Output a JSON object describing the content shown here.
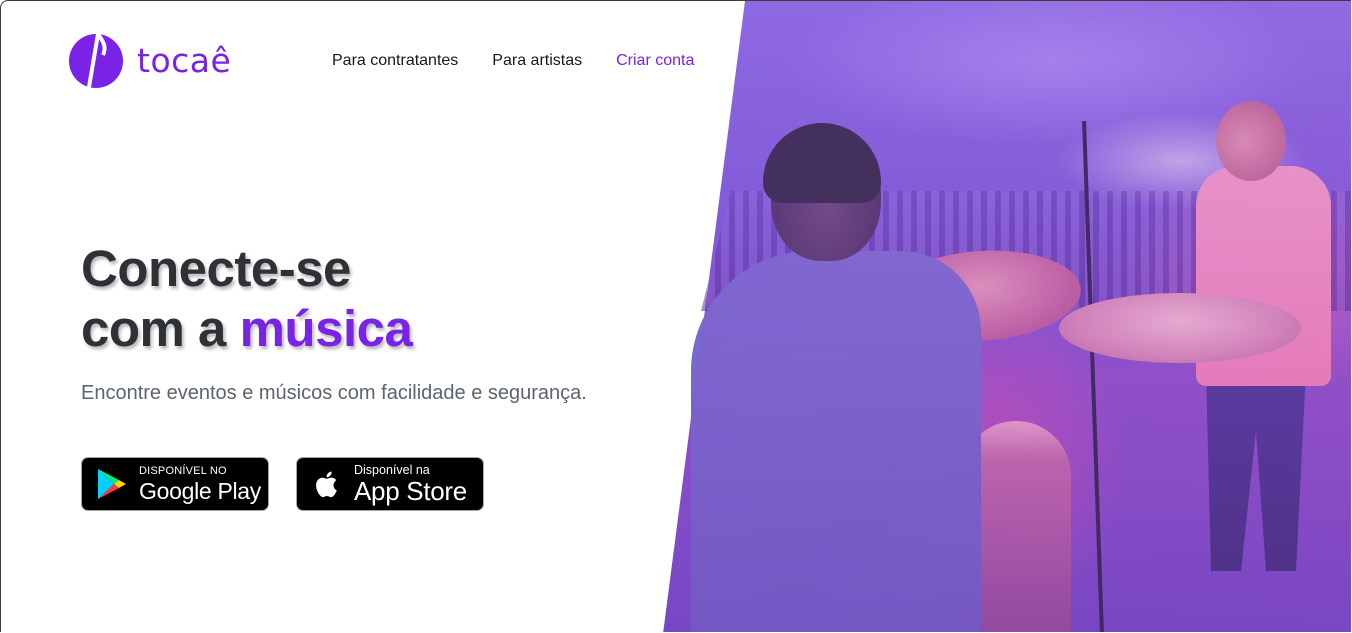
{
  "brand": {
    "name": "tocaê",
    "accent_color": "#7a22e6",
    "logo_icon": "tocae-logo-icon"
  },
  "nav": {
    "items": [
      {
        "label": "Para contratantes"
      },
      {
        "label": "Para artistas"
      },
      {
        "label": "Criar conta",
        "accent": true
      }
    ]
  },
  "hero": {
    "headline_line1": "Conecte-se",
    "headline_line2_prefix": "com a ",
    "headline_highlight": "música",
    "subtitle": "Encontre eventos e músicos com facilidade e segurança.",
    "heading_color": "#2e3136",
    "subtitle_color": "#5c6470"
  },
  "stores": {
    "google_play": {
      "small": "DISPONÍVEL NO",
      "big": "Google Play",
      "icon": "google-play-icon"
    },
    "app_store": {
      "small": "Disponível na",
      "big": "App Store",
      "icon": "apple-icon"
    }
  }
}
